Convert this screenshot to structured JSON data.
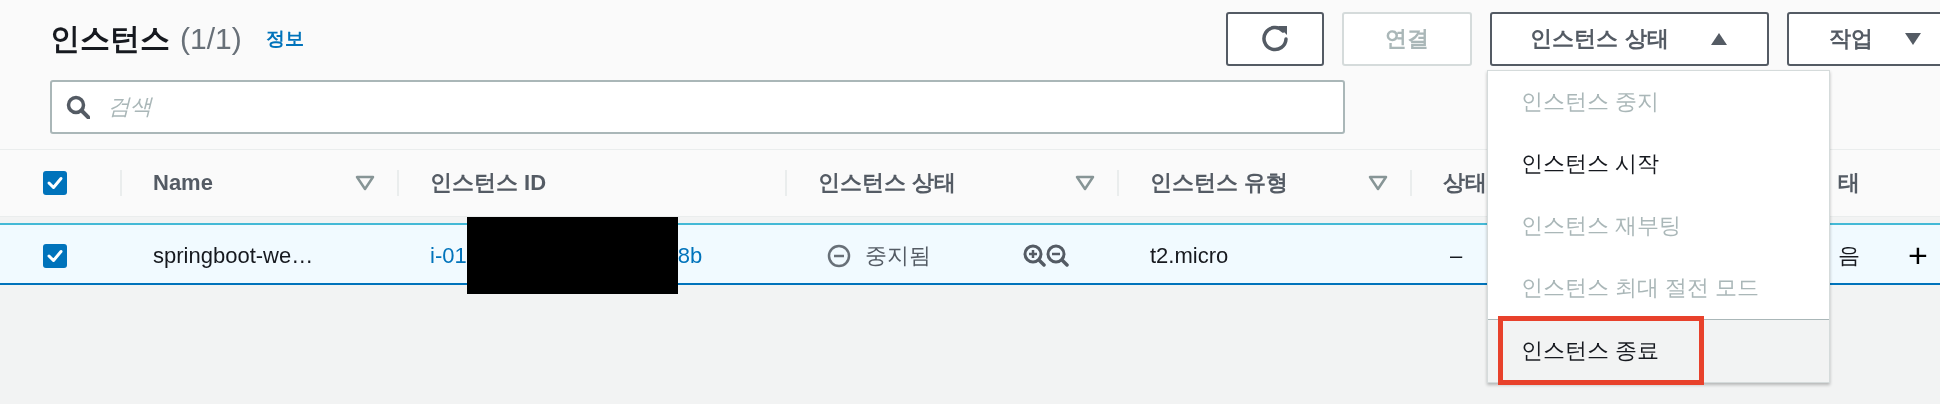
{
  "header": {
    "title": "인스턴스",
    "count": "(1/1)",
    "info_link": "정보"
  },
  "toolbar": [
    {
      "kind": "refresh",
      "disabled": false
    },
    {
      "kind": "text",
      "label": "연결",
      "disabled": true
    },
    {
      "kind": "dropdown",
      "label": "인스턴스 상태",
      "disabled": false,
      "expanded": true
    },
    {
      "kind": "dropdown",
      "label": "작업",
      "disabled": false,
      "expanded": false
    }
  ],
  "search": {
    "placeholder": "검색"
  },
  "table": {
    "select_all": {
      "checked": true
    },
    "columns": [
      {
        "label": "Name",
        "sortable": true
      },
      {
        "label": "인스턴스 ID",
        "sortable": false
      },
      {
        "label": "인스턴스 상태",
        "sortable": true
      },
      {
        "label": "인스턴스 유형",
        "sortable": true
      },
      {
        "label": "상태",
        "sortable": false
      },
      {
        "label": "태",
        "sortable": false
      }
    ],
    "rows": [
      {
        "selected": true,
        "checked": true,
        "name": "springboot-we…",
        "instance_id_start": "i-01",
        "redacted": true,
        "instance_id_end": "8b",
        "state": {
          "kind": "stopped",
          "label": "중지됨"
        },
        "type": "t2.micro",
        "column_5": "–",
        "column_6": "음",
        "expand": "+"
      }
    ]
  },
  "state_menu": {
    "items": [
      {
        "label": "인스턴스 중지",
        "disabled": true,
        "highlighted": false
      },
      {
        "label": "인스턴스 시작",
        "disabled": false,
        "highlighted": false
      },
      {
        "label": "인스턴스 재부팅",
        "disabled": true,
        "highlighted": false
      },
      {
        "label": "인스턴스 최대 절전 모드",
        "disabled": true,
        "highlighted": false
      },
      {
        "label": "인스턴스 종료",
        "disabled": false,
        "highlighted": true
      }
    ]
  }
}
